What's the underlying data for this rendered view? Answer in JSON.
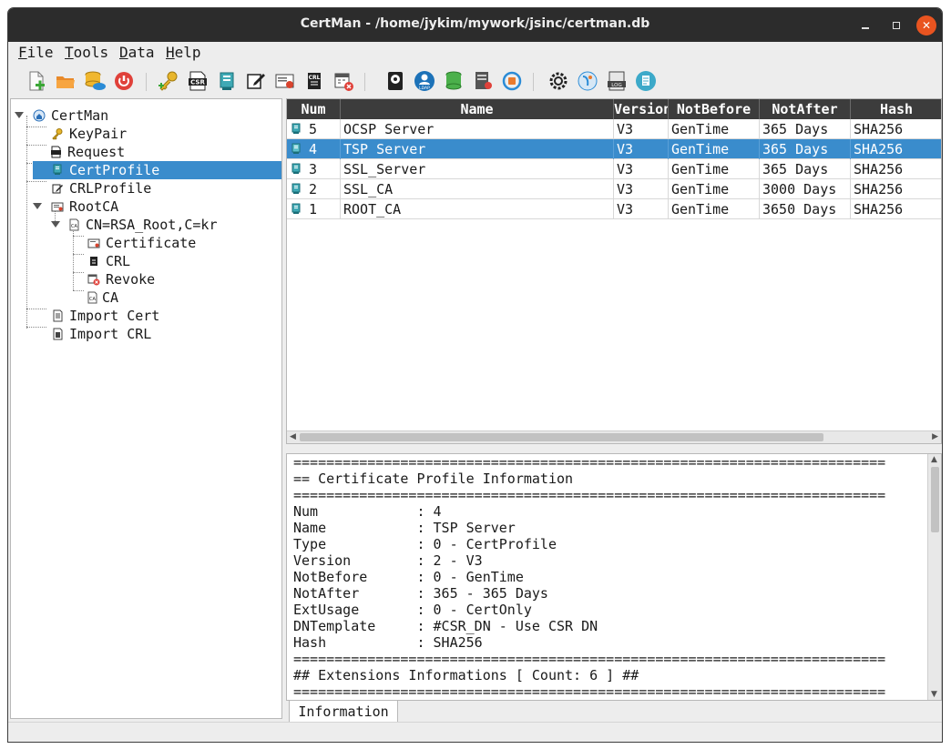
{
  "window": {
    "title": "CertMan - /home/jykim/mywork/jsinc/certman.db"
  },
  "menu": [
    {
      "label": "File",
      "mnemonic": "F",
      "rest": "ile"
    },
    {
      "label": "Tools",
      "mnemonic": "T",
      "rest": "ools"
    },
    {
      "label": "Data",
      "mnemonic": "D",
      "rest": "ata"
    },
    {
      "label": "Help",
      "mnemonic": "H",
      "rest": "elp"
    }
  ],
  "toolbar": {
    "icons": [
      "new-file-icon",
      "open-folder-icon",
      "remote-db-icon",
      "server-power-icon",
      "new-keypair-icon",
      "csr-icon",
      "cert-profile-icon",
      "crl-profile-icon",
      "make-certificate-icon",
      "make-crl-icon",
      "revoke-icon",
      "hsm-icon",
      "ldap-icon",
      "ldap-db-icon",
      "server-status-icon",
      "refresh-icon",
      "settings-icon",
      "about-icon",
      "log-icon",
      "document-icon"
    ],
    "csr_label": "CSR",
    "ldap_label": "LDAP",
    "log_label": "LOG",
    "crl_label": "CRL"
  },
  "tree": {
    "root": "CertMan",
    "keypair": "KeyPair",
    "request": "Request",
    "cert_profile": "CertProfile",
    "crl_profile": "CRLProfile",
    "root_ca": "RootCA",
    "ca_node": "CN=RSA_Root,C=kr",
    "certificate": "Certificate",
    "crl": "CRL",
    "revoke": "Revoke",
    "ca": "CA",
    "import_cert": "Import Cert",
    "import_crl": "Import CRL"
  },
  "table": {
    "columns": [
      "Num",
      "Name",
      "Version",
      "NotBefore",
      "NotAfter",
      "Hash"
    ],
    "rows": [
      {
        "num": "5",
        "name": "OCSP Server",
        "version": "V3",
        "notbefore": "GenTime",
        "notafter": "365 Days",
        "hash": "SHA256"
      },
      {
        "num": "4",
        "name": "TSP Server",
        "version": "V3",
        "notbefore": "GenTime",
        "notafter": "365 Days",
        "hash": "SHA256"
      },
      {
        "num": "3",
        "name": "SSL_Server",
        "version": "V3",
        "notbefore": "GenTime",
        "notafter": "365 Days",
        "hash": "SHA256"
      },
      {
        "num": "2",
        "name": "SSL_CA",
        "version": "V3",
        "notbefore": "GenTime",
        "notafter": "3000 Days",
        "hash": "SHA256"
      },
      {
        "num": "1",
        "name": "ROOT_CA",
        "version": "V3",
        "notbefore": "GenTime",
        "notafter": "3650 Days",
        "hash": "SHA256"
      }
    ]
  },
  "info": {
    "separator": "========================================================================",
    "header": "== Certificate Profile Information",
    "fields": [
      {
        "key": "Num",
        "value": "4"
      },
      {
        "key": "Name",
        "value": "TSP Server"
      },
      {
        "key": "Type",
        "value": "0 - CertProfile"
      },
      {
        "key": "Version",
        "value": "2 - V3"
      },
      {
        "key": "NotBefore",
        "value": "0 - GenTime"
      },
      {
        "key": "NotAfter",
        "value": "365 - 365 Days"
      },
      {
        "key": "ExtUsage",
        "value": "0 - CertOnly"
      },
      {
        "key": "DNTemplate",
        "value": "#CSR_DN - Use CSR DN"
      },
      {
        "key": "Hash",
        "value": "SHA256"
      }
    ],
    "extensions_header": "## Extensions Informations [ Count: 6 ] ##"
  },
  "tabs": {
    "information": "Information"
  },
  "colors": {
    "selection": "#3a8ccc",
    "titlebar": "#2c2c2c",
    "close": "#e95420",
    "header": "#3c3c3c"
  }
}
